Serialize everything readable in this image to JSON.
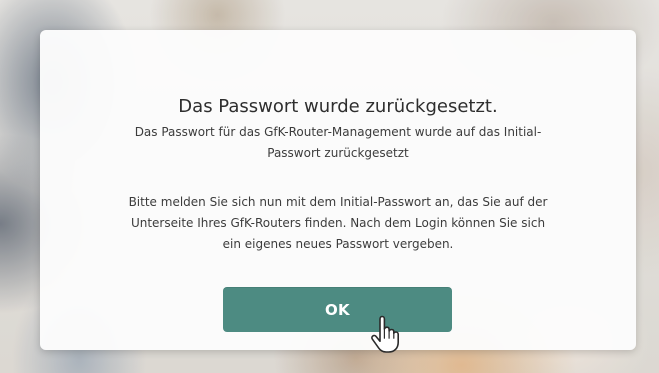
{
  "dialog": {
    "title": "Das Passwort wurde zurückgesetzt.",
    "paragraphs": [
      "Das Passwort für das GfK-Router-Management wurde auf das Initial-Passwort zurückgesetzt",
      "Bitte melden Sie sich nun mit dem Initial-Passwort an, das Sie auf der Unterseite Ihres GfK-Routers finden. Nach dem Login können Sie sich ein eigenes neues Passwort vergeben."
    ],
    "ok_label": "OK"
  },
  "colors": {
    "button_bg": "#4d8b82",
    "button_text": "#ffffff",
    "dialog_bg": "#fcfcfc",
    "text": "#3c3c3c"
  },
  "icons": {
    "cursor": "hand-cursor-icon"
  }
}
